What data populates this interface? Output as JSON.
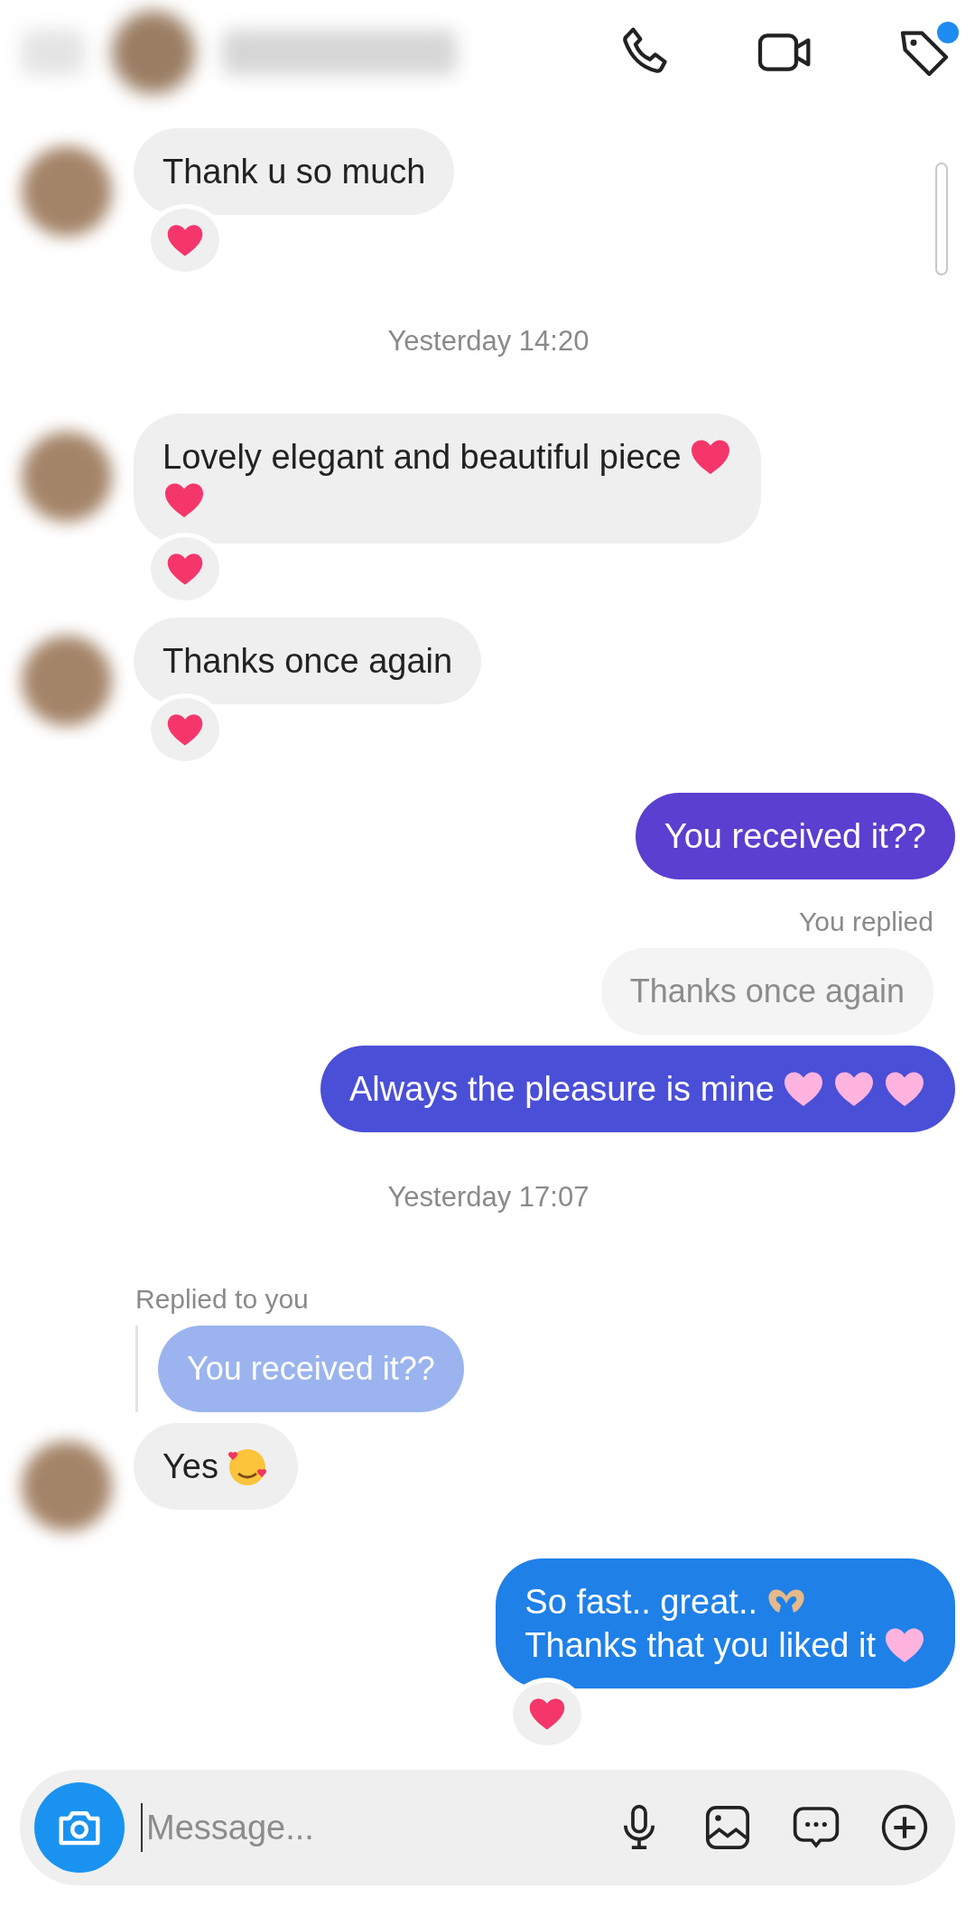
{
  "header": {
    "tag_notification": true
  },
  "items": [
    {
      "kind": "incoming",
      "reacted": true,
      "lines": [
        [
          {
            "kind": "text",
            "text": "Thank u so much"
          }
        ]
      ]
    },
    {
      "kind": "timestamp",
      "text": "Yesterday 14:20"
    },
    {
      "kind": "incoming",
      "reacted": true,
      "lines": [
        [
          {
            "kind": "text",
            "text": "Lovely elegant and beautiful piece"
          },
          {
            "kind": "heart"
          }
        ],
        [
          {
            "kind": "heart"
          }
        ]
      ]
    },
    {
      "kind": "incoming",
      "reacted": true,
      "lines": [
        [
          {
            "kind": "text",
            "text": "Thanks once again"
          }
        ]
      ]
    },
    {
      "kind": "outgoing",
      "color": "#5a3fd0",
      "reacted": false,
      "lines": [
        [
          {
            "kind": "text",
            "text": "You received it??"
          }
        ]
      ]
    },
    {
      "kind": "reply_out",
      "label": "You replied",
      "quote": "Thanks once again"
    },
    {
      "kind": "outgoing",
      "color": "#4a4fd7",
      "reacted": false,
      "lines": [
        [
          {
            "kind": "text",
            "text": "Always the pleasure is mine"
          },
          {
            "kind": "pink_heart"
          },
          {
            "kind": "pink_heart"
          },
          {
            "kind": "pink_heart"
          }
        ]
      ]
    },
    {
      "kind": "timestamp",
      "text": "Yesterday 17:07"
    },
    {
      "kind": "reply_in",
      "label": "Replied to you",
      "quote": "You received it??"
    },
    {
      "kind": "incoming",
      "reacted": false,
      "lines": [
        [
          {
            "kind": "text",
            "text": "Yes"
          },
          {
            "kind": "smiling_hearts"
          }
        ]
      ]
    },
    {
      "kind": "outgoing",
      "color": "#1f80e8",
      "reacted": true,
      "lines": [
        [
          {
            "kind": "text",
            "text": "So fast.. great.."
          },
          {
            "kind": "heart_hands"
          }
        ],
        [
          {
            "kind": "text",
            "text": "Thanks that you liked it"
          },
          {
            "kind": "pink_heart"
          }
        ]
      ]
    }
  ],
  "composer": {
    "placeholder": "Message..."
  }
}
